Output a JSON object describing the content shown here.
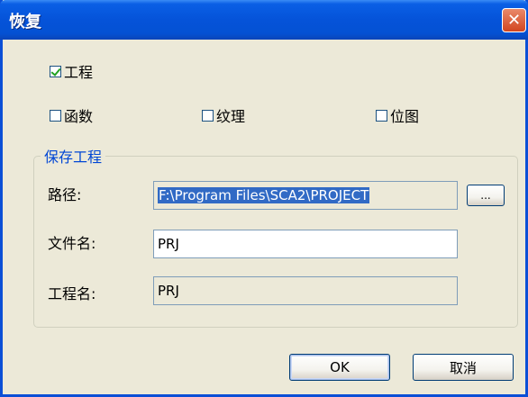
{
  "window": {
    "title": "恢复",
    "close_glyph": "✕"
  },
  "options": {
    "project": {
      "label": "工程",
      "checked": true
    },
    "function": {
      "label": "函数",
      "checked": false
    },
    "texture": {
      "label": "纹理",
      "checked": false
    },
    "bitmap": {
      "label": "位图",
      "checked": false
    }
  },
  "save_group": {
    "title": "保存工程",
    "path_label": "路径:",
    "path_value": "F:\\Program Files\\SCA2\\PROJECT",
    "browse_label": "...",
    "filename_label": "文件名:",
    "filename_value": "PRJ",
    "projectname_label": "工程名:",
    "projectname_value": "PRJ"
  },
  "buttons": {
    "ok": "OK",
    "cancel": "取消"
  },
  "colors": {
    "titlebar": "#0553d9",
    "group_title": "#0046d5",
    "selection": "#316ac5",
    "close_button": "#d2451f"
  }
}
